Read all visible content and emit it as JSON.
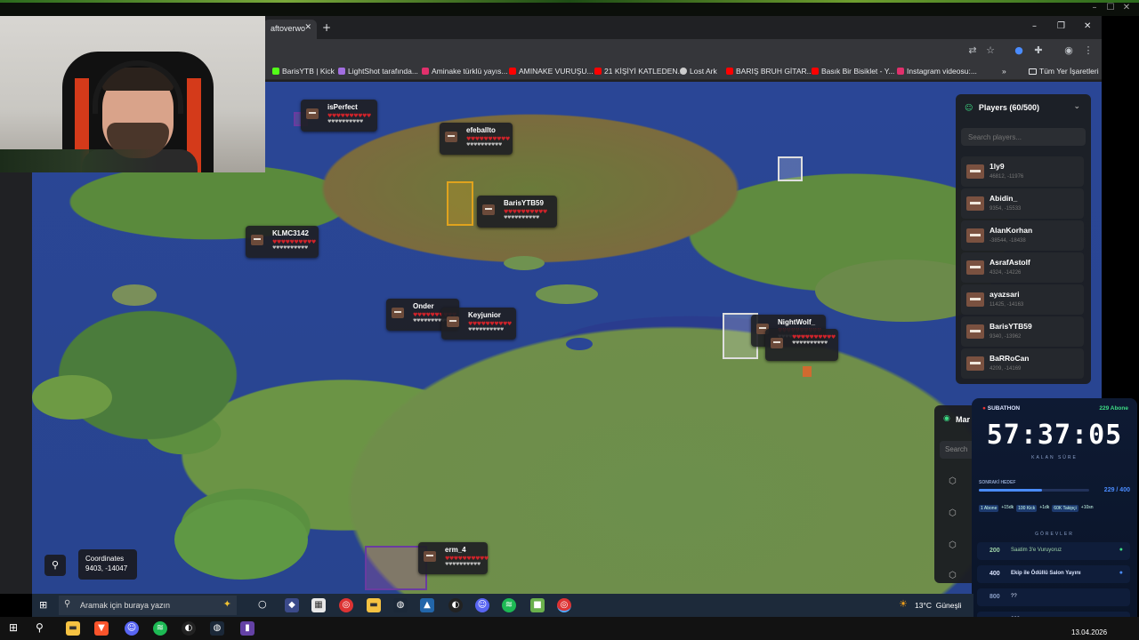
{
  "browser": {
    "tab_title": "aftoverwo",
    "bookmarks": [
      {
        "label": "BarisYTB | Kick",
        "color": "#53fc18"
      },
      {
        "label": "LightShot tarafında...",
        "color": "#a26ee0"
      },
      {
        "label": "Aminake türklü yayıs...",
        "color": "#e1306c"
      },
      {
        "label": "AMINAKE VURUŞU...",
        "color": "#ff0000"
      },
      {
        "label": "21 KİŞİYİ KATLEDEN...",
        "color": "#ff0000"
      },
      {
        "label": "Lost Ark",
        "color": "#cccccc"
      },
      {
        "label": "BARIŞ BRUH GİTAR...",
        "color": "#ff0000"
      },
      {
        "label": "Basık Bir Bisiklet - Y...",
        "color": "#ff0000"
      },
      {
        "label": "Instagram videosu:...",
        "color": "#e1306c"
      }
    ],
    "all_bookmarks_label": "Tüm Yer İşaretleri",
    "more_label": "»"
  },
  "map": {
    "players_on_map": [
      {
        "name": "isPerfect"
      },
      {
        "name": "efeballto"
      },
      {
        "name": "BarisYTB59"
      },
      {
        "name": "KLMC3142"
      },
      {
        "name": "Onder"
      },
      {
        "name": "Keyjunior"
      },
      {
        "name": "NightWolf_"
      },
      {
        "name": "erm_4"
      }
    ],
    "hearts": "♥♥♥♥♥♥♥♥♥♥",
    "food": "♥♥♥♥♥♥♥♥♥♥",
    "coords_label": "Coordinates",
    "coords_value": "9403, -14047"
  },
  "players_panel": {
    "title": "Players (60/500)",
    "search_placeholder": "Search players...",
    "players": [
      {
        "name": "1ly9",
        "coords": "46812, -11976"
      },
      {
        "name": "Abidin_",
        "coords": "9354, -15533"
      },
      {
        "name": "AlanKorhan",
        "coords": "-38544, -18438"
      },
      {
        "name": "AsrafAstolf",
        "coords": "4324, -14226"
      },
      {
        "name": "ayazsari",
        "coords": "11425, -14163"
      },
      {
        "name": "BarisYTB59",
        "coords": "9340, -13962"
      },
      {
        "name": "BaRRoCan",
        "coords": "4209, -14169"
      }
    ]
  },
  "markers_panel": {
    "title": "Mar",
    "search_placeholder": "Search"
  },
  "subathon": {
    "badge": "SUBATHON",
    "subs": "229 Abone",
    "timer": "57:37:05",
    "timer_caption": "KALAN SÜRE",
    "next_goal_label": "SONRAKİ HEDEF",
    "progress_text": "229 / 400",
    "progress_fraction": 0.57,
    "rates": [
      "1 Abone",
      "+15dk",
      "100 Kick",
      "+1dk",
      "60K Takipçi",
      "+10sn"
    ],
    "tasks_label": "GÖREVLER",
    "tasks": [
      {
        "num": "200",
        "label": "Saatim 3'e Vuruyoruz"
      },
      {
        "num": "400",
        "label": "Ekip ile Ödüllü Salon Yayını"
      },
      {
        "num": "800",
        "label": "??"
      },
      {
        "num": "800",
        "label": "???"
      }
    ]
  },
  "inner_taskbar": {
    "search_placeholder": "Aramak için buraya yazın",
    "weather": "13°C  Güneşli"
  },
  "taskbar": {
    "date": "13.04.2026"
  }
}
